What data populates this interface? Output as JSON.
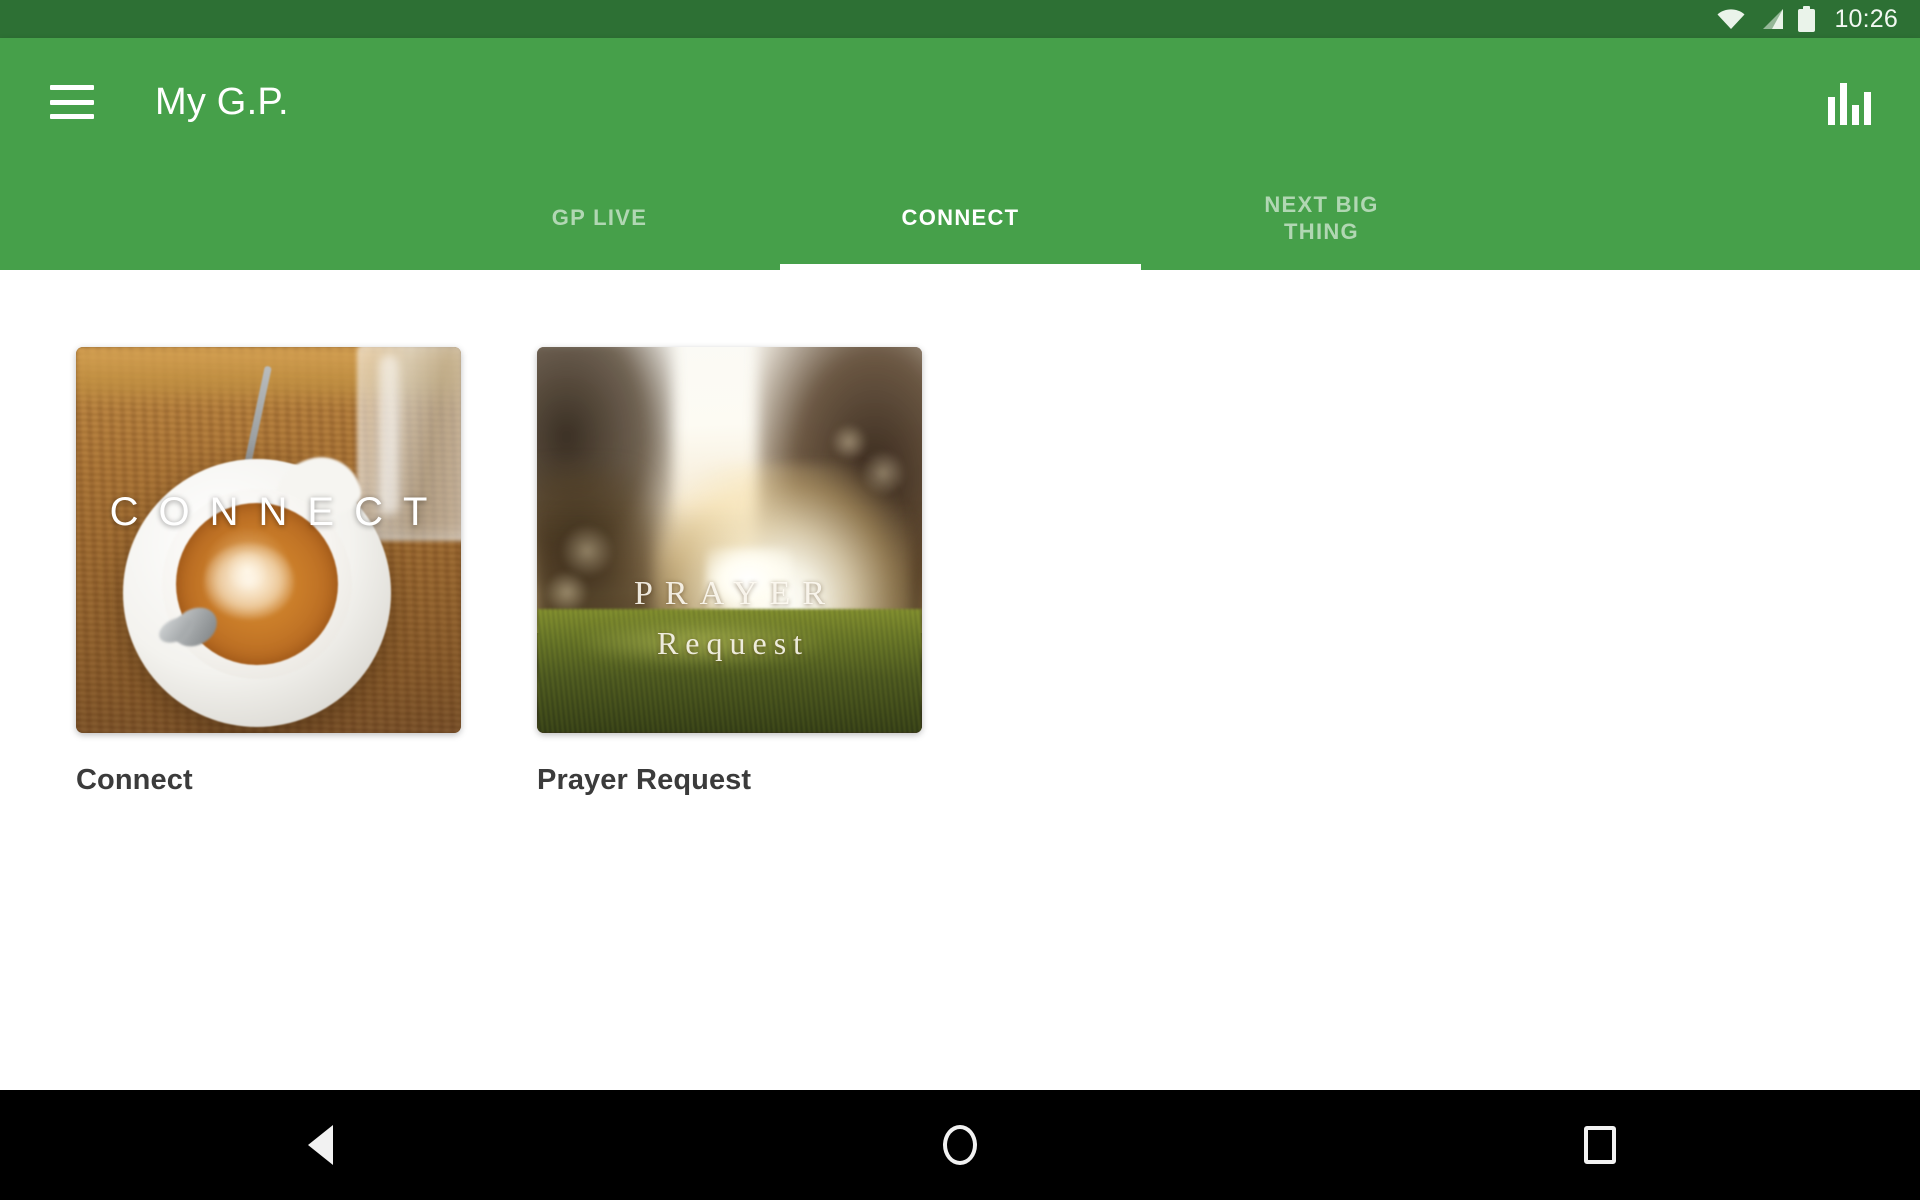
{
  "status_bar": {
    "time": "10:26",
    "icons": [
      "wifi-icon",
      "cellular-signal-icon",
      "battery-icon"
    ]
  },
  "app_bar": {
    "menu_icon": "hamburger-menu-icon",
    "title": "My G.P.",
    "action_icon": "bar-chart-icon",
    "background_color": "#46a04a",
    "status_bar_color": "#2d7034"
  },
  "tabs": {
    "items": [
      {
        "label": "GP LIVE",
        "active": false
      },
      {
        "label": "CONNECT",
        "active": true
      },
      {
        "label": "NEXT BIG\nTHING",
        "active": false
      }
    ],
    "active_index": 1,
    "indicator_color": "#ffffff",
    "inactive_color": "rgba(255,255,255,0.58)"
  },
  "content": {
    "cards": [
      {
        "title": "Connect",
        "overlay_text": "CONNECT",
        "image_description": "coffee-cup-on-wooden-table"
      },
      {
        "title": "Prayer Request",
        "overlay_line1": "PRAYER",
        "overlay_line2": "Request",
        "image_description": "sunset-over-grass-field"
      }
    ],
    "background_color": "#ffffff",
    "title_color": "#3b3b3b"
  },
  "nav_bar": {
    "buttons": [
      {
        "name": "back-button",
        "icon": "triangle-back-icon"
      },
      {
        "name": "home-button",
        "icon": "circle-home-icon"
      },
      {
        "name": "recents-button",
        "icon": "square-recents-icon"
      }
    ],
    "background_color": "#000000"
  }
}
